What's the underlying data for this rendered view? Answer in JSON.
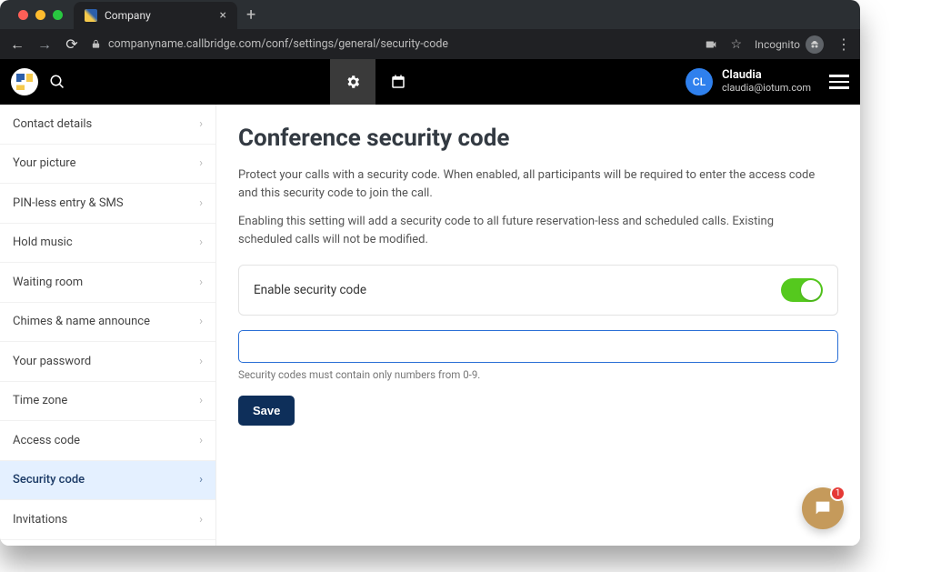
{
  "browser": {
    "tab_title": "Company",
    "url": "companyname.callbridge.com/conf/settings/general/security-code",
    "incognito_label": "Incognito"
  },
  "header": {
    "user_initials": "CL",
    "user_name": "Claudia",
    "user_email": "claudia@iotum.com"
  },
  "sidebar": {
    "items": [
      {
        "label": "Contact details"
      },
      {
        "label": "Your picture"
      },
      {
        "label": "PIN-less entry & SMS"
      },
      {
        "label": "Hold music"
      },
      {
        "label": "Waiting room"
      },
      {
        "label": "Chimes & name announce"
      },
      {
        "label": "Your password"
      },
      {
        "label": "Time zone"
      },
      {
        "label": "Access code"
      },
      {
        "label": "Security code"
      },
      {
        "label": "Invitations"
      }
    ],
    "active_index": 9
  },
  "main": {
    "title": "Conference security code",
    "desc1": "Protect your calls with a security code. When enabled, all participants will be required to enter the access code and this security code to join the call.",
    "desc2": "Enabling this setting will add a security code to all future reservation-less and scheduled calls. Existing scheduled calls will not be modified.",
    "toggle_label": "Enable security code",
    "toggle_on": true,
    "code_value": "",
    "hint": "Security codes must contain only numbers from 0-9.",
    "save_label": "Save"
  },
  "chat": {
    "badge": "1"
  },
  "colors": {
    "accent": "#2a6fd6",
    "toggle_on": "#55c91e",
    "save_bg": "#0e2f5a",
    "chat_bg": "#c59a5b",
    "badge_bg": "#e53935"
  }
}
